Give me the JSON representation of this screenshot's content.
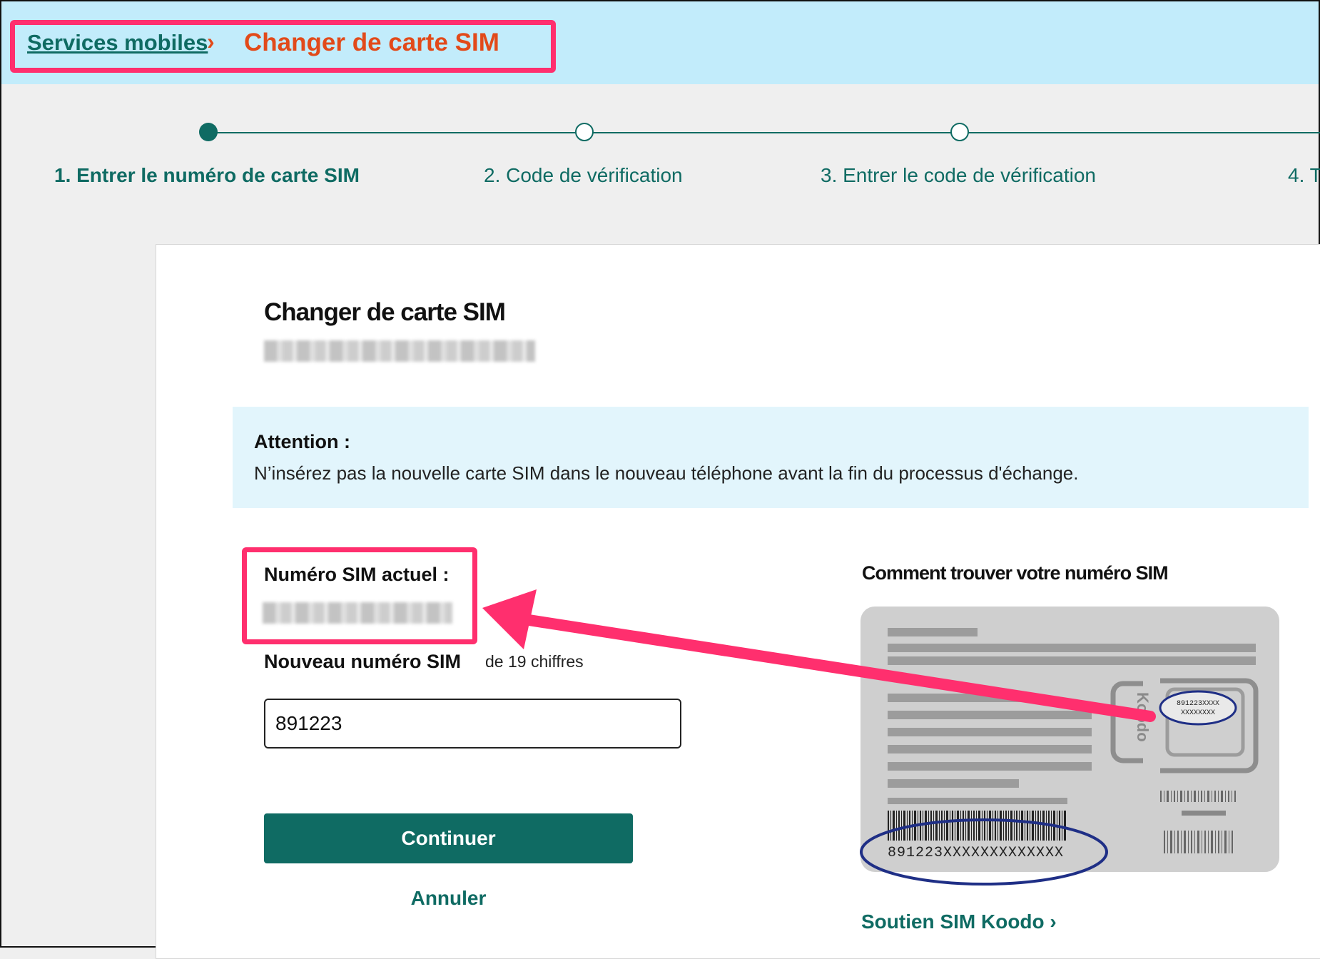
{
  "breadcrumb": {
    "parent_label": "Services mobiles",
    "separator": "›",
    "current_label": "Changer de carte SIM"
  },
  "stepper": {
    "steps": [
      {
        "label": "1. Entrer le numéro de carte SIM",
        "state": "active"
      },
      {
        "label": "2. Code de vérification",
        "state": "todo"
      },
      {
        "label": "3. Entrer le code de vérification",
        "state": "todo"
      },
      {
        "label": "4. T",
        "state": "todo"
      }
    ]
  },
  "card": {
    "title": "Changer de carte SIM",
    "alert": {
      "title": "Attention :",
      "text": "N’insérez pas la nouvelle carte SIM dans le nouveau téléphone avant la fin du processus d'échange."
    },
    "current_sim_label": "Numéro SIM actuel :",
    "new_sim_label": "Nouveau numéro SIM",
    "new_sim_hint": "de 19 chiffres",
    "new_sim_value": "891223",
    "continue_label": "Continuer",
    "cancel_label": "Annuler",
    "how_title": "Comment trouver votre numéro SIM",
    "sim_image": {
      "brand": "Koodo",
      "chip_number_line1": "891223XXXX",
      "chip_number_line2": "XXXXXXXX",
      "barcode_number": "891223XXXXXXXXXXXXX"
    },
    "support_label": "Soutien SIM Koodo",
    "support_chevron": "›"
  },
  "colors": {
    "brand_teal": "#0f6b63",
    "accent_orange": "#e24a1a",
    "highlight_pink": "#ff2f6e",
    "header_bg": "#c2ecfb",
    "alert_bg": "#e2f5fc",
    "annotation_ellipse": "#1f2f86"
  }
}
